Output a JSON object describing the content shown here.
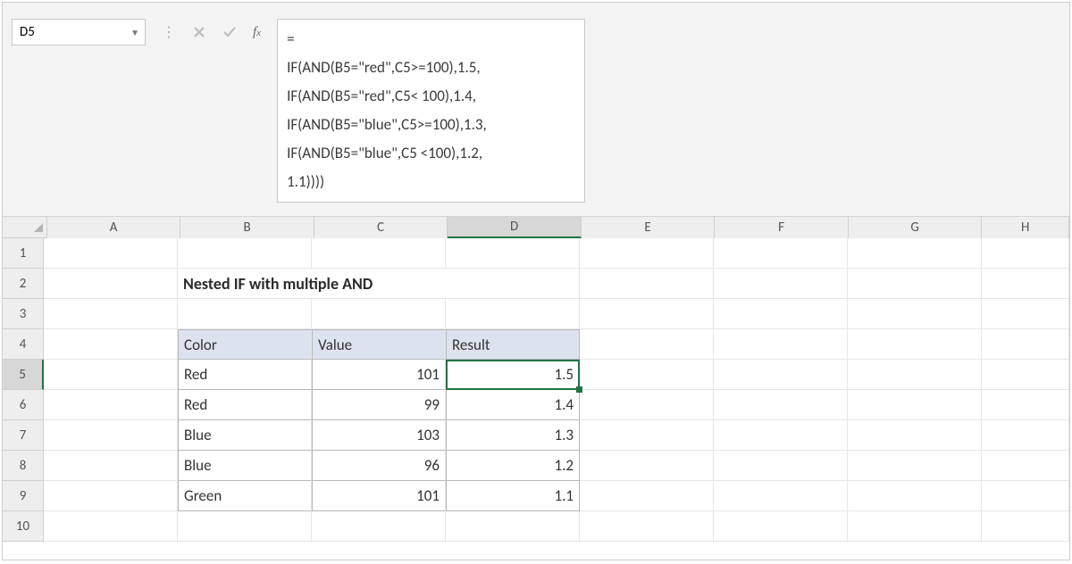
{
  "namebox": {
    "value": "D5"
  },
  "formula": {
    "line1": "=",
    "line2": "IF(AND(B5=\"red\",C5>=100),1.5,",
    "line3": "IF(AND(B5=\"red\",C5< 100),1.4,",
    "line4": "IF(AND(B5=\"blue\",C5>=100),1.3,",
    "line5": "IF(AND(B5=\"blue\",C5 <100),1.2,",
    "line6": "1.1))))"
  },
  "columns": [
    "A",
    "B",
    "C",
    "D",
    "E",
    "F",
    "G",
    "H"
  ],
  "rows": [
    "1",
    "2",
    "3",
    "4",
    "5",
    "6",
    "7",
    "8",
    "9",
    "10"
  ],
  "active": {
    "col": "D",
    "row": "5"
  },
  "sheet": {
    "title": "Nested IF with multiple AND",
    "headers": {
      "B": "Color",
      "C": "Value",
      "D": "Result"
    },
    "data": [
      {
        "color": "Red",
        "value": "101",
        "result": "1.5"
      },
      {
        "color": "Red",
        "value": "99",
        "result": "1.4"
      },
      {
        "color": "Blue",
        "value": "103",
        "result": "1.3"
      },
      {
        "color": "Blue",
        "value": "96",
        "result": "1.2"
      },
      {
        "color": "Green",
        "value": "101",
        "result": "1.1"
      }
    ]
  }
}
